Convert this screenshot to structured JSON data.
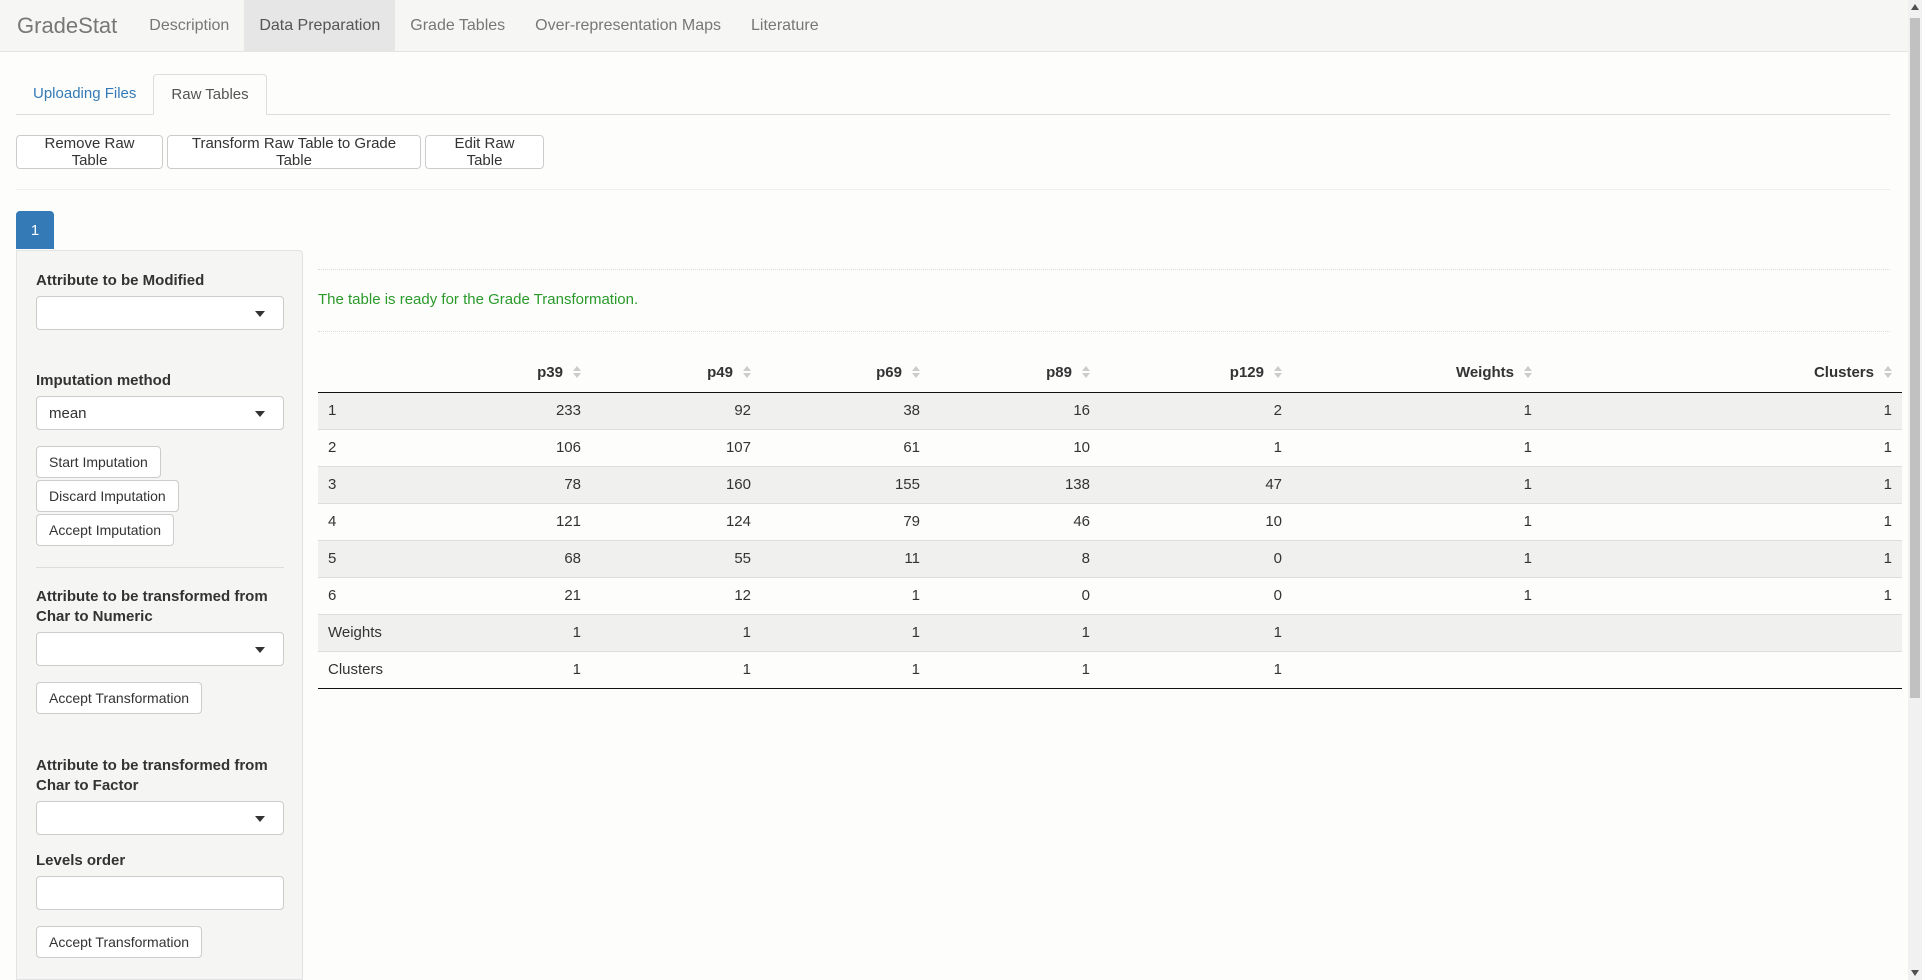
{
  "navbar": {
    "brand": "GradeStat",
    "items": [
      {
        "label": "Description"
      },
      {
        "label": "Data Preparation"
      },
      {
        "label": "Grade Tables"
      },
      {
        "label": "Over-representation Maps"
      },
      {
        "label": "Literature"
      }
    ]
  },
  "subtabs": [
    {
      "label": "Uploading Files"
    },
    {
      "label": "Raw Tables"
    }
  ],
  "toolbar": {
    "remove": "Remove Raw Table",
    "transform": "Transform Raw Table to Grade Table",
    "edit": "Edit Raw Table"
  },
  "table_tab": "1",
  "sidebar": {
    "attr_modified_label": "Attribute to be Modified",
    "attr_modified_value": "",
    "imputation_label": "Imputation method",
    "imputation_value": "mean",
    "start_imputation": "Start Imputation",
    "discard_imputation": "Discard Imputation",
    "accept_imputation": "Accept Imputation",
    "char_numeric_label_1": "Attribute to be transformed from",
    "char_numeric_label_2": "Char to Numeric",
    "char_numeric_value": "",
    "accept_transformation_1": "Accept Transformation",
    "char_factor_label_1": "Attribute to be transformed from",
    "char_factor_label_2": "Char to Factor",
    "char_factor_value": "",
    "levels_order_label": "Levels order",
    "levels_order_value": "",
    "accept_transformation_2": "Accept Transformation"
  },
  "status_message": "The table is ready for the Grade Transformation.",
  "table": {
    "headers": [
      "",
      "p39",
      "p49",
      "p69",
      "p89",
      "p129",
      "Weights",
      "Clusters"
    ],
    "rows": [
      [
        "1",
        "233",
        "92",
        "38",
        "16",
        "2",
        "1",
        "1"
      ],
      [
        "2",
        "106",
        "107",
        "61",
        "10",
        "1",
        "1",
        "1"
      ],
      [
        "3",
        "78",
        "160",
        "155",
        "138",
        "47",
        "1",
        "1"
      ],
      [
        "4",
        "121",
        "124",
        "79",
        "46",
        "10",
        "1",
        "1"
      ],
      [
        "5",
        "68",
        "55",
        "11",
        "8",
        "0",
        "1",
        "1"
      ],
      [
        "6",
        "21",
        "12",
        "1",
        "0",
        "0",
        "1",
        "1"
      ],
      [
        "Weights",
        "1",
        "1",
        "1",
        "1",
        "1",
        "",
        ""
      ],
      [
        "Clusters",
        "1",
        "1",
        "1",
        "1",
        "1",
        "",
        ""
      ]
    ]
  }
}
